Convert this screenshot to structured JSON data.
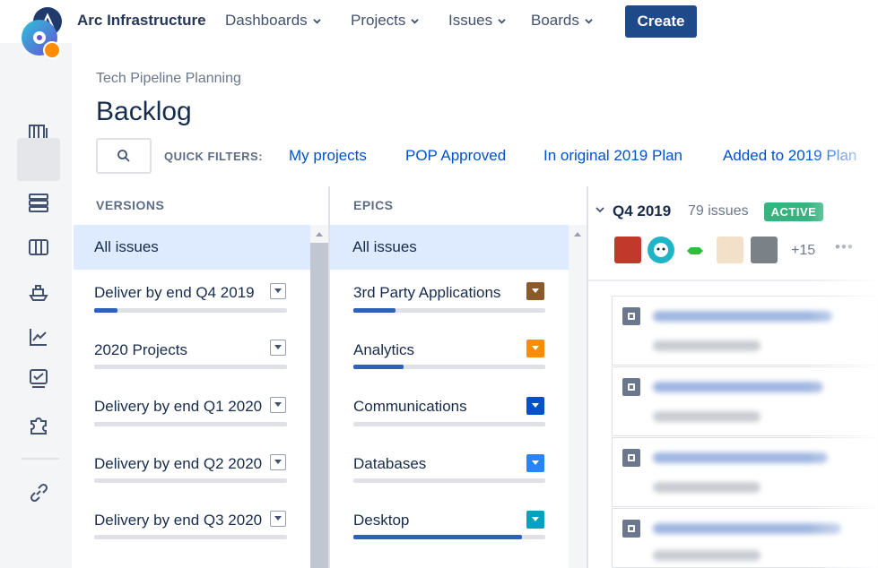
{
  "topnav": {
    "brand": "Arc Infrastructure",
    "items": [
      {
        "label": "Dashboards"
      },
      {
        "label": "Projects"
      },
      {
        "label": "Issues"
      },
      {
        "label": "Boards"
      }
    ],
    "create_label": "Create"
  },
  "header": {
    "breadcrumb": "Tech Pipeline Planning",
    "title": "Backlog"
  },
  "quick_filters": {
    "label": "QUICK FILTERS:",
    "items": [
      "My projects",
      "POP Approved",
      "In original 2019 Plan",
      "Added to 2019 Plan"
    ]
  },
  "versions": {
    "heading": "VERSIONS",
    "all_label": "All issues",
    "items": [
      {
        "label": "Deliver by end Q4 2019",
        "progress": 0.12
      },
      {
        "label": "2020 Projects",
        "progress": 0
      },
      {
        "label": "Delivery by end Q1 2020",
        "progress": 0
      },
      {
        "label": "Delivery by end Q2 2020",
        "progress": 0
      },
      {
        "label": "Delivery by end Q3 2020",
        "progress": 0
      }
    ]
  },
  "epics": {
    "heading": "EPICS",
    "all_label": "All issues",
    "items": [
      {
        "label": "3rd Party Applications",
        "progress": 0.22,
        "color": "#8b5a2b"
      },
      {
        "label": "Analytics",
        "progress": 0.26,
        "color": "#ff8b00"
      },
      {
        "label": "Communications",
        "progress": 0,
        "color": "#0052cc"
      },
      {
        "label": "Databases",
        "progress": 0,
        "color": "#2684ff"
      },
      {
        "label": "Desktop",
        "progress": 0.88,
        "color": "#00a3bf"
      }
    ]
  },
  "sprint": {
    "name": "Q4 2019",
    "count": "79 issues",
    "status": "ACTIVE",
    "more_assignees": "+15",
    "ellipsis": "•••"
  },
  "colors": {
    "accent": "#0052cc",
    "primary_button": "#1e4a8a",
    "active_lozenge": "#36b37e",
    "selected_row": "#deebff"
  }
}
